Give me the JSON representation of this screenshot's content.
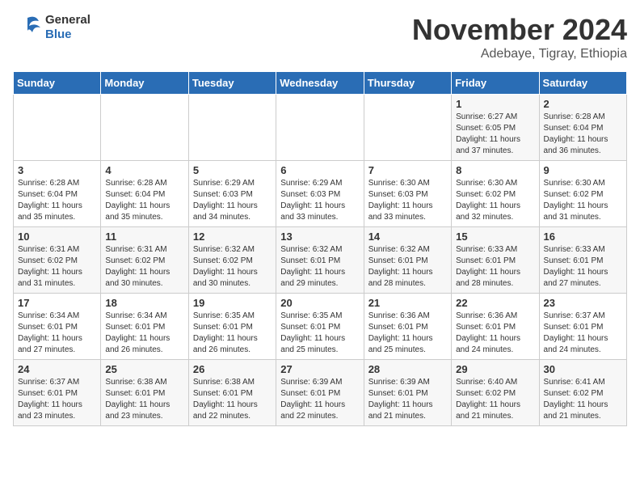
{
  "header": {
    "logo_general": "General",
    "logo_blue": "Blue",
    "title": "November 2024",
    "location": "Adebaye, Tigray, Ethiopia"
  },
  "weekdays": [
    "Sunday",
    "Monday",
    "Tuesday",
    "Wednesday",
    "Thursday",
    "Friday",
    "Saturday"
  ],
  "weeks": [
    [
      {
        "day": "",
        "info": ""
      },
      {
        "day": "",
        "info": ""
      },
      {
        "day": "",
        "info": ""
      },
      {
        "day": "",
        "info": ""
      },
      {
        "day": "",
        "info": ""
      },
      {
        "day": "1",
        "info": "Sunrise: 6:27 AM\nSunset: 6:05 PM\nDaylight: 11 hours\nand 37 minutes."
      },
      {
        "day": "2",
        "info": "Sunrise: 6:28 AM\nSunset: 6:04 PM\nDaylight: 11 hours\nand 36 minutes."
      }
    ],
    [
      {
        "day": "3",
        "info": "Sunrise: 6:28 AM\nSunset: 6:04 PM\nDaylight: 11 hours\nand 35 minutes."
      },
      {
        "day": "4",
        "info": "Sunrise: 6:28 AM\nSunset: 6:04 PM\nDaylight: 11 hours\nand 35 minutes."
      },
      {
        "day": "5",
        "info": "Sunrise: 6:29 AM\nSunset: 6:03 PM\nDaylight: 11 hours\nand 34 minutes."
      },
      {
        "day": "6",
        "info": "Sunrise: 6:29 AM\nSunset: 6:03 PM\nDaylight: 11 hours\nand 33 minutes."
      },
      {
        "day": "7",
        "info": "Sunrise: 6:30 AM\nSunset: 6:03 PM\nDaylight: 11 hours\nand 33 minutes."
      },
      {
        "day": "8",
        "info": "Sunrise: 6:30 AM\nSunset: 6:02 PM\nDaylight: 11 hours\nand 32 minutes."
      },
      {
        "day": "9",
        "info": "Sunrise: 6:30 AM\nSunset: 6:02 PM\nDaylight: 11 hours\nand 31 minutes."
      }
    ],
    [
      {
        "day": "10",
        "info": "Sunrise: 6:31 AM\nSunset: 6:02 PM\nDaylight: 11 hours\nand 31 minutes."
      },
      {
        "day": "11",
        "info": "Sunrise: 6:31 AM\nSunset: 6:02 PM\nDaylight: 11 hours\nand 30 minutes."
      },
      {
        "day": "12",
        "info": "Sunrise: 6:32 AM\nSunset: 6:02 PM\nDaylight: 11 hours\nand 30 minutes."
      },
      {
        "day": "13",
        "info": "Sunrise: 6:32 AM\nSunset: 6:01 PM\nDaylight: 11 hours\nand 29 minutes."
      },
      {
        "day": "14",
        "info": "Sunrise: 6:32 AM\nSunset: 6:01 PM\nDaylight: 11 hours\nand 28 minutes."
      },
      {
        "day": "15",
        "info": "Sunrise: 6:33 AM\nSunset: 6:01 PM\nDaylight: 11 hours\nand 28 minutes."
      },
      {
        "day": "16",
        "info": "Sunrise: 6:33 AM\nSunset: 6:01 PM\nDaylight: 11 hours\nand 27 minutes."
      }
    ],
    [
      {
        "day": "17",
        "info": "Sunrise: 6:34 AM\nSunset: 6:01 PM\nDaylight: 11 hours\nand 27 minutes."
      },
      {
        "day": "18",
        "info": "Sunrise: 6:34 AM\nSunset: 6:01 PM\nDaylight: 11 hours\nand 26 minutes."
      },
      {
        "day": "19",
        "info": "Sunrise: 6:35 AM\nSunset: 6:01 PM\nDaylight: 11 hours\nand 26 minutes."
      },
      {
        "day": "20",
        "info": "Sunrise: 6:35 AM\nSunset: 6:01 PM\nDaylight: 11 hours\nand 25 minutes."
      },
      {
        "day": "21",
        "info": "Sunrise: 6:36 AM\nSunset: 6:01 PM\nDaylight: 11 hours\nand 25 minutes."
      },
      {
        "day": "22",
        "info": "Sunrise: 6:36 AM\nSunset: 6:01 PM\nDaylight: 11 hours\nand 24 minutes."
      },
      {
        "day": "23",
        "info": "Sunrise: 6:37 AM\nSunset: 6:01 PM\nDaylight: 11 hours\nand 24 minutes."
      }
    ],
    [
      {
        "day": "24",
        "info": "Sunrise: 6:37 AM\nSunset: 6:01 PM\nDaylight: 11 hours\nand 23 minutes."
      },
      {
        "day": "25",
        "info": "Sunrise: 6:38 AM\nSunset: 6:01 PM\nDaylight: 11 hours\nand 23 minutes."
      },
      {
        "day": "26",
        "info": "Sunrise: 6:38 AM\nSunset: 6:01 PM\nDaylight: 11 hours\nand 22 minutes."
      },
      {
        "day": "27",
        "info": "Sunrise: 6:39 AM\nSunset: 6:01 PM\nDaylight: 11 hours\nand 22 minutes."
      },
      {
        "day": "28",
        "info": "Sunrise: 6:39 AM\nSunset: 6:01 PM\nDaylight: 11 hours\nand 21 minutes."
      },
      {
        "day": "29",
        "info": "Sunrise: 6:40 AM\nSunset: 6:02 PM\nDaylight: 11 hours\nand 21 minutes."
      },
      {
        "day": "30",
        "info": "Sunrise: 6:41 AM\nSunset: 6:02 PM\nDaylight: 11 hours\nand 21 minutes."
      }
    ]
  ]
}
